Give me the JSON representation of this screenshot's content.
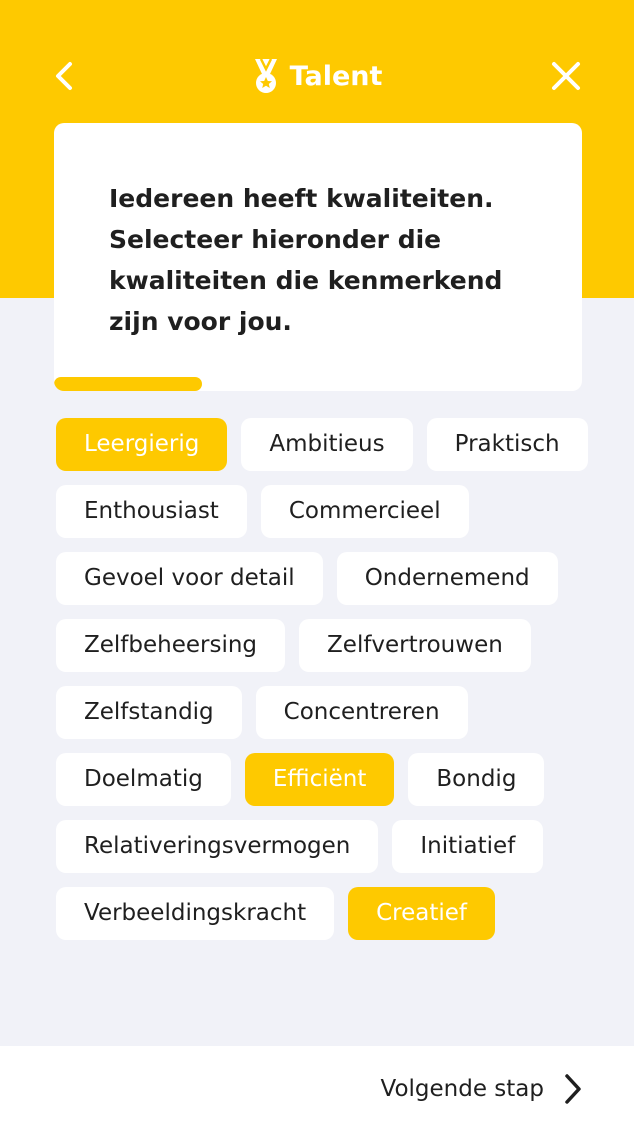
{
  "header": {
    "title": "Talent",
    "icons": {
      "back": "chevron-left-icon",
      "close": "close-icon",
      "title": "medal-icon"
    },
    "background_color": "#fec900"
  },
  "card": {
    "lines": [
      "Iedereen heeft kwaliteiten.",
      "Selecteer hieronder die",
      "kwaliteiten die kenmerkend",
      "zijn voor jou."
    ],
    "progress": 0.28
  },
  "tags": [
    {
      "label": "Leergierig",
      "selected": true
    },
    {
      "label": "Ambitieus",
      "selected": false
    },
    {
      "label": "Praktisch",
      "selected": false
    },
    {
      "label": "Enthousiast",
      "selected": false
    },
    {
      "label": "Commercieel",
      "selected": false
    },
    {
      "label": "Gevoel voor detail",
      "selected": false
    },
    {
      "label": "Ondernemend",
      "selected": false
    },
    {
      "label": "Zelfbeheersing",
      "selected": false
    },
    {
      "label": "Zelfvertrouwen",
      "selected": false
    },
    {
      "label": "Zelfstandig",
      "selected": false
    },
    {
      "label": "Concentreren",
      "selected": false
    },
    {
      "label": "Doelmatig",
      "selected": false
    },
    {
      "label": "Efficiënt",
      "selected": true
    },
    {
      "label": "Bondig",
      "selected": false
    },
    {
      "label": "Relativeringsvermogen",
      "selected": false
    },
    {
      "label": "Initiatief",
      "selected": false
    },
    {
      "label": "Verbeeldingskracht",
      "selected": false
    },
    {
      "label": "Creatief",
      "selected": true
    }
  ],
  "footer": {
    "next_label": "Volgende stap",
    "next_icon": "chevron-right-icon"
  },
  "colors": {
    "accent": "#fec900",
    "background": "#f1f2f8",
    "text": "#1f1f1f"
  }
}
